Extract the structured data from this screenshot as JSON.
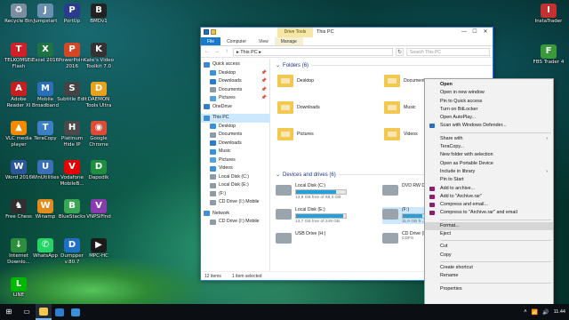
{
  "desktop": {
    "left_icons": [
      {
        "label": "Recycle Bin",
        "icon": "recycle-bin-icon",
        "color": "#7a8ea0",
        "glyph": "♻"
      },
      {
        "label": "Jumpstart",
        "icon": "jumpstart-icon",
        "color": "#6a8fb0",
        "glyph": "J"
      },
      {
        "label": "PortUp",
        "icon": "portup-icon",
        "color": "#2d3b8f",
        "glyph": "P"
      },
      {
        "label": "BMDv1",
        "icon": "bmdv1-icon",
        "color": "#222222",
        "glyph": "B"
      },
      {
        "label": "TELKOMSEL Flash",
        "icon": "telkomsel-icon",
        "color": "#d12027",
        "glyph": "T"
      },
      {
        "label": "Excel 2016",
        "icon": "excel-icon",
        "color": "#1f7244",
        "glyph": "X"
      },
      {
        "label": "PowerPoint 2016",
        "icon": "powerpoint-icon",
        "color": "#d24726",
        "glyph": "P"
      },
      {
        "label": "Kate's Video Toolkit 7.0",
        "icon": "kate-video-icon",
        "color": "#333333",
        "glyph": "K"
      },
      {
        "label": "Adobe Reader XI",
        "icon": "adobe-reader-icon",
        "color": "#c71f1f",
        "glyph": "A"
      },
      {
        "label": "Mobile Broadband",
        "icon": "mobile-broadband-icon",
        "color": "#2a6fbb",
        "glyph": "M"
      },
      {
        "label": "Subtitle Edit",
        "icon": "subtitle-edit-icon",
        "color": "#444444",
        "glyph": "S"
      },
      {
        "label": "DAEMON Tools Ultra",
        "icon": "daemon-tools-icon",
        "color": "#e8a21c",
        "glyph": "D"
      },
      {
        "label": "VLC media player",
        "icon": "vlc-icon",
        "color": "#f08a00",
        "glyph": "▲"
      },
      {
        "label": "TeraCopy",
        "icon": "teracopy-icon",
        "color": "#3d7fc4",
        "glyph": "T"
      },
      {
        "label": "Platinum Hide IP",
        "icon": "hide-ip-icon",
        "color": "#4a4a4a",
        "glyph": "H"
      },
      {
        "label": "Google Chrome",
        "icon": "chrome-icon",
        "color": "#dd4b39",
        "glyph": "◉"
      },
      {
        "label": "Word 2016",
        "icon": "word-icon",
        "color": "#2b579a",
        "glyph": "W"
      },
      {
        "label": "WinUtilities",
        "icon": "winutilities-icon",
        "color": "#3b6fb6",
        "glyph": "U"
      },
      {
        "label": "Vodafone MobileB...",
        "icon": "vodafone-icon",
        "color": "#e60000",
        "glyph": "V"
      },
      {
        "label": "Dapodik",
        "icon": "dapodik-icon",
        "color": "#1e8e3e",
        "glyph": "D"
      },
      {
        "label": "Free Chess",
        "icon": "chess-icon",
        "color": "#2f2f2f",
        "glyph": "♞"
      },
      {
        "label": "Winamp",
        "icon": "winamp-icon",
        "color": "#e38b1c",
        "glyph": "W"
      },
      {
        "label": "BlueStacks",
        "icon": "bluestacks-icon",
        "color": "#3aa655",
        "glyph": "B"
      },
      {
        "label": "VNPSIFind",
        "icon": "vnpsifind-icon",
        "color": "#8a3bb0",
        "glyph": "V"
      },
      {
        "label": "Internet Downlo...",
        "icon": "idm-icon",
        "color": "#2c8f3e",
        "glyph": "↓"
      },
      {
        "label": "WhatsApp",
        "icon": "whatsapp-icon",
        "color": "#25d366",
        "glyph": "✆"
      },
      {
        "label": "Dumpper v.80.7",
        "icon": "dumpper-icon",
        "color": "#1f6fc5",
        "glyph": "D"
      },
      {
        "label": "MPC-HC",
        "icon": "mpc-hc-icon",
        "color": "#1b1b1b",
        "glyph": "▶"
      },
      {
        "label": "LINE",
        "icon": "line-icon",
        "color": "#00b900",
        "glyph": "L"
      }
    ],
    "right_icons": [
      {
        "label": "InstaTrader",
        "icon": "instatrader-icon",
        "color": "#c53030",
        "glyph": "I"
      },
      {
        "label": "FBS Trader 4",
        "icon": "fbs-trader-icon",
        "color": "#3a9a3a",
        "glyph": "F"
      }
    ]
  },
  "window": {
    "context_tab": "Drive Tools",
    "title": "This PC",
    "controls": {
      "minimize": "—",
      "maximize": "☐",
      "close": "✕"
    },
    "ribbon_tabs": [
      "File",
      "Computer",
      "View",
      "Manage"
    ],
    "address": {
      "back": "←",
      "forward": "→",
      "up": "↑",
      "path": "▸ This PC ▸",
      "refresh": "↻",
      "search_placeholder": "Search This PC"
    },
    "nav": [
      {
        "label": "Quick access",
        "color": "#3b86d6",
        "pin": ""
      },
      {
        "label": "Desktop",
        "color": "#3d8fd8",
        "pin": "📌"
      },
      {
        "label": "Downloads",
        "color": "#2d7bc9",
        "pin": "📌"
      },
      {
        "label": "Documents",
        "color": "#8e9aa6",
        "pin": "📌"
      },
      {
        "label": "Pictures",
        "color": "#5aa0d8",
        "pin": "📌"
      },
      {
        "label": "OneDrive",
        "color": "#2f7dd1",
        "pin": ""
      },
      {
        "label": "This PC",
        "color": "#3c8fd6",
        "pin": ""
      },
      {
        "label": "Desktop",
        "color": "#3d8fd8",
        "pin": ""
      },
      {
        "label": "Documents",
        "color": "#8e9aa6",
        "pin": ""
      },
      {
        "label": "Downloads",
        "color": "#2d7bc9",
        "pin": ""
      },
      {
        "label": "Music",
        "color": "#3d8fd8",
        "pin": ""
      },
      {
        "label": "Pictures",
        "color": "#5aa0d8",
        "pin": ""
      },
      {
        "label": "Videos",
        "color": "#3d8fd8",
        "pin": ""
      },
      {
        "label": "Local Disk (C:)",
        "color": "#8e9aa6",
        "pin": ""
      },
      {
        "label": "Local Disk (E:)",
        "color": "#8e9aa6",
        "pin": ""
      },
      {
        "label": "(F:)",
        "color": "#8e9aa6",
        "pin": ""
      },
      {
        "label": "CD Drive (I:) Mobile",
        "color": "#8e9aa6",
        "pin": ""
      },
      {
        "label": "Network",
        "color": "#3d8fd8",
        "pin": ""
      },
      {
        "label": "CD Drive (I:) Mobile",
        "color": "#8e9aa6",
        "pin": ""
      }
    ],
    "folders_header": "Folders (6)",
    "folders": [
      {
        "label": "Desktop"
      },
      {
        "label": "Documents"
      },
      {
        "label": "Downloads"
      },
      {
        "label": "Music"
      },
      {
        "label": "Pictures"
      },
      {
        "label": "Videos"
      }
    ],
    "drives_header": "Devices and drives (6)",
    "drives": [
      {
        "name": "Local Disk (C:)",
        "free": "13,8 GB free of 68,3 GB",
        "used_fraction": 0.8
      },
      {
        "name": "DVD RW D...",
        "free": "",
        "used_fraction": null
      },
      {
        "name": "Local Disk (E:)",
        "free": "13,7 GB free of 249 GB",
        "used_fraction": 0.94
      },
      {
        "name": "(F:)",
        "free": "11,8 GB fr...",
        "used_fraction": 0.4
      },
      {
        "name": "USB Drive (H:)",
        "free": "",
        "used_fraction": null
      },
      {
        "name": "CD Drive (I:)",
        "free": "CDFS",
        "used_fraction": null
      }
    ],
    "status": {
      "count": "12 items",
      "selection": "1 item selected"
    }
  },
  "context_menu": {
    "items": [
      {
        "label": "Open",
        "bold": true,
        "icon": "",
        "submenu": false,
        "sep_after": false
      },
      {
        "label": "Open in new window",
        "bold": false,
        "icon": "",
        "submenu": false,
        "sep_after": false
      },
      {
        "label": "Pin to Quick access",
        "bold": false,
        "icon": "",
        "submenu": false,
        "sep_after": false
      },
      {
        "label": "Turn on BitLocker",
        "bold": false,
        "icon": "",
        "submenu": false,
        "sep_after": false
      },
      {
        "label": "Open AutoPlay...",
        "bold": false,
        "icon": "",
        "submenu": false,
        "sep_after": false
      },
      {
        "label": "Scan with Windows Defender...",
        "bold": false,
        "icon": "defender-icon",
        "submenu": false,
        "sep_after": true
      },
      {
        "label": "Share with",
        "bold": false,
        "icon": "",
        "submenu": true,
        "sep_after": false
      },
      {
        "label": "TeraCopy...",
        "bold": false,
        "icon": "",
        "submenu": false,
        "sep_after": false
      },
      {
        "label": "New folder with selection",
        "bold": false,
        "icon": "",
        "submenu": false,
        "sep_after": false
      },
      {
        "label": "Open as Portable Device",
        "bold": false,
        "icon": "",
        "submenu": false,
        "sep_after": false
      },
      {
        "label": "Include in library",
        "bold": false,
        "icon": "",
        "submenu": true,
        "sep_after": false
      },
      {
        "label": "Pin to Start",
        "bold": false,
        "icon": "",
        "submenu": false,
        "sep_after": false
      },
      {
        "label": "Add to archive...",
        "bold": false,
        "icon": "winrar-icon",
        "submenu": false,
        "sep_after": false
      },
      {
        "label": "Add to \"Archive.rar\"",
        "bold": false,
        "icon": "winrar-icon",
        "submenu": false,
        "sep_after": false
      },
      {
        "label": "Compress and email...",
        "bold": false,
        "icon": "winrar-icon",
        "submenu": false,
        "sep_after": false
      },
      {
        "label": "Compress to \"Archive.rar\" and email",
        "bold": false,
        "icon": "winrar-icon",
        "submenu": false,
        "sep_after": true
      },
      {
        "label": "Format...",
        "bold": false,
        "icon": "",
        "submenu": false,
        "sep_after": false,
        "highlighted": true
      },
      {
        "label": "Eject",
        "bold": false,
        "icon": "",
        "submenu": false,
        "sep_after": true
      },
      {
        "label": "Cut",
        "bold": false,
        "icon": "",
        "submenu": false,
        "sep_after": false
      },
      {
        "label": "Copy",
        "bold": false,
        "icon": "",
        "submenu": false,
        "sep_after": true
      },
      {
        "label": "Create shortcut",
        "bold": false,
        "icon": "",
        "submenu": false,
        "sep_after": false
      },
      {
        "label": "Rename",
        "bold": false,
        "icon": "",
        "submenu": false,
        "sep_after": true
      },
      {
        "label": "Properties",
        "bold": false,
        "icon": "",
        "submenu": false,
        "sep_after": false
      }
    ]
  },
  "taskbar": {
    "start": "⊞",
    "task_view": "▭",
    "apps": [
      {
        "icon": "file-explorer-icon",
        "color": "#f3c850",
        "active": true
      },
      {
        "icon": "edge-icon",
        "color": "#2f7dd1",
        "active": false
      },
      {
        "icon": "store-icon",
        "color": "#3d8fd8",
        "active": false
      }
    ],
    "tray": {
      "chevron": "˄",
      "network": "📶",
      "volume": "🔊",
      "time": "11.44",
      "date": ""
    }
  }
}
